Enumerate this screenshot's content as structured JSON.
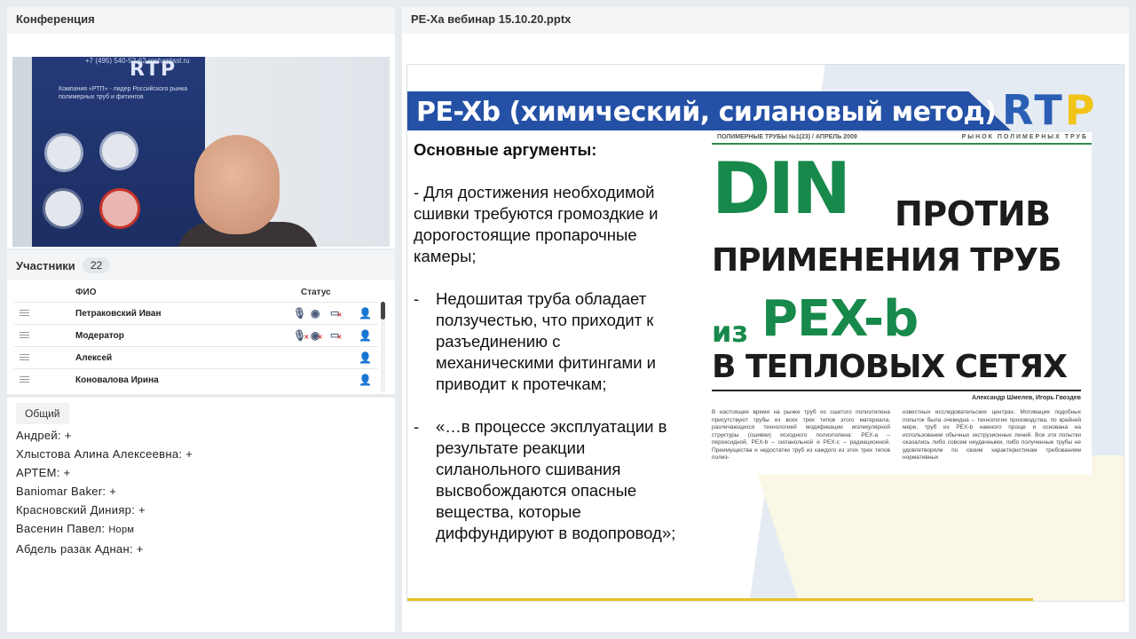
{
  "conference": {
    "title": "Конференция",
    "banner_phone": "+7 (495) 540-52-62  rosturplast.ru",
    "banner_logo": "RTP",
    "banner_text": "Компания «РТП» - лидер Российского рынка полимерных труб и фитингов"
  },
  "participants": {
    "title": "Участники",
    "count": "22",
    "col_name": "ФИО",
    "col_status": "Статус",
    "rows": [
      {
        "name": "Петраковский Иван"
      },
      {
        "name": "Модератор"
      },
      {
        "name": "Алексей"
      },
      {
        "name": "Коновалова  Ирина"
      }
    ]
  },
  "chat": {
    "tab": "Общий",
    "messages": [
      {
        "text": "Андрей: +"
      },
      {
        "text": "Хлыстова Алина  Алексеевна: +"
      },
      {
        "text": "АРТЕМ: +"
      },
      {
        "text": "Baniomar Baker: +"
      },
      {
        "text": "Красновский Динияр: +"
      },
      {
        "text": "Васенин Павел: ",
        "small": "Норм"
      },
      {
        "text": "Абдель разак Аднан: +"
      }
    ]
  },
  "presentation": {
    "title": "PE-Xa вебинар 15.10.20.pptx",
    "slide": {
      "title": "PE-Xb (химический, силановый метод)",
      "logo": "RTP",
      "heading": "Основные аргументы:",
      "point1": "- Для достижения необходимой сшивки требуются громоздкие и дорогостоящие пропарочные камеры;",
      "point2_dash": "-",
      "point2": "Недошитая труба обладает ползучестью, что приходит к разъединению с механическими фитингами и приводит к протечкам;",
      "point3_dash": "-",
      "point3": "«…в процессе эксплуатации в результате реакции силанольного сшивания высвобождаются опасные вещества, которые диффундируют в водопровод»;",
      "magazine": {
        "header_left": "ПОЛИМЕРНЫЕ ТРУБЫ №1(23) / АПРЕЛЬ 2009",
        "header_right": "РЫНОК ПОЛИМЕРНЫХ ТРУБ",
        "din": "DIN",
        "protiv": "ПРОТИВ",
        "line2": "ПРИМЕНЕНИЯ ТРУБ",
        "iz": "из",
        "pexb": "PEX-b",
        "line4": "В ТЕПЛОВЫХ СЕТЯХ",
        "authors": "Александр Шмелев, Игорь Гвоздев",
        "col1": "В настоящее время на рынке труб из сшитого полиэтилена присутствуют трубы из всех трех типов этого материала, различающихся технологией модификации молекулярной структуры (сшивки) исходного полиэтилена: PEX-a – пероксидной, PEX-b – силанольной и PEX-c – радиационной. Преимущества и недостатки труб из каждого из этих трех типов полиэ-",
        "col2": "известных исследовательских центрах. Мотивация подобных попыток была очевидна – технология производства, по крайней мере, труб из PEX-b намного проще и основана на использовании обычных экструзионных линий. Все эти попытки оказались либо совсем неудачными, либо полученные трубы не удовлетворяли по своим характеристикам требованиям нормативных"
      }
    }
  },
  "colors": {
    "title_bar": "#2451a6",
    "din_green": "#16894b",
    "accent_gold": "#e8c22c"
  }
}
